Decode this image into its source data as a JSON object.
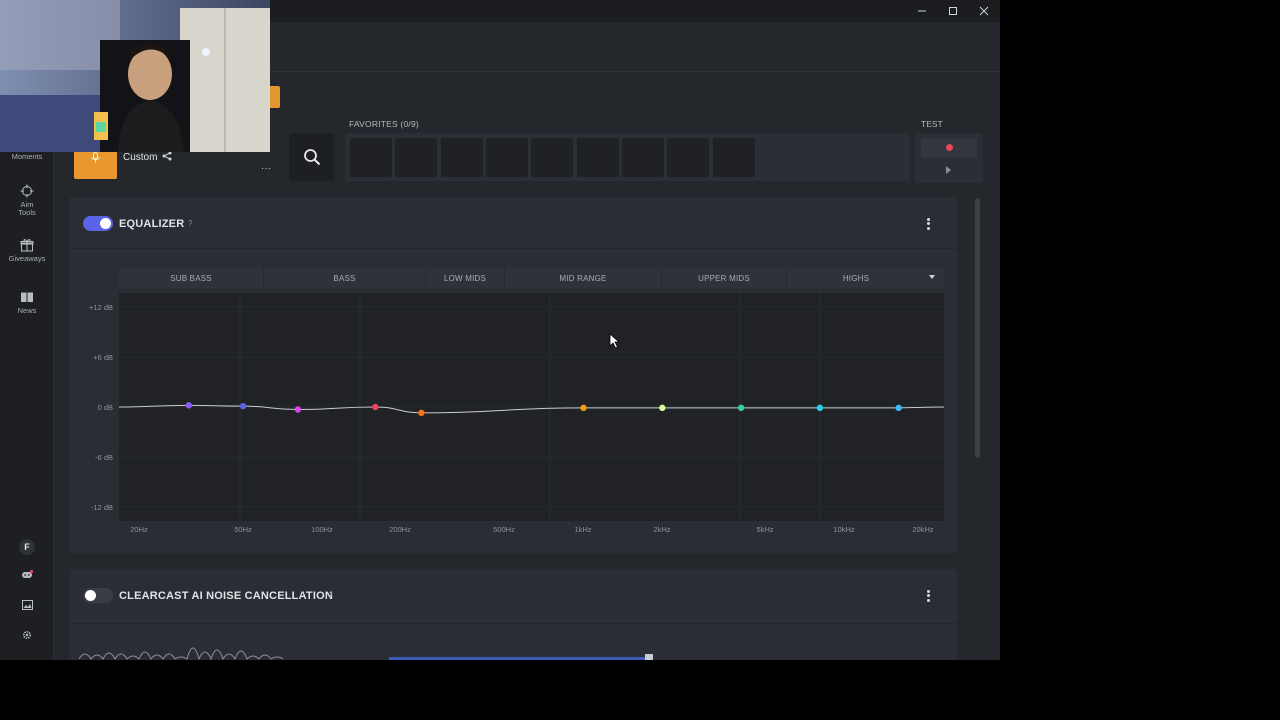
{
  "window": {
    "minimize_icon": "minimize-icon",
    "maximize_icon": "maximize-icon",
    "close_icon": "close-icon"
  },
  "sidebar": {
    "items": [
      {
        "label": "Moments",
        "icon": "moments-icon"
      },
      {
        "label": "Aim\nTools",
        "icon": "crosshair-icon"
      },
      {
        "label": "Giveaways",
        "icon": "gift-icon"
      },
      {
        "label": "News",
        "icon": "newspaper-icon"
      }
    ],
    "profile_initial": "F",
    "bottom_icons": [
      "discord-icon",
      "image-icon",
      "settings-icon"
    ]
  },
  "preset": {
    "name": "Custom",
    "share_icon": "share-icon",
    "more_label": "···"
  },
  "favorites": {
    "label": "FAVORITES (0/9)",
    "slots": 9
  },
  "test": {
    "label": "TEST",
    "record_color": "#e8455b"
  },
  "equalizer": {
    "title": "EQUALIZER",
    "help": "?",
    "enabled": true,
    "toggle_color": "#5b63e8",
    "bands": [
      "SUB BASS",
      "BASS",
      "LOW MIDS",
      "MID RANGE",
      "UPPER MIDS",
      "HIGHS"
    ],
    "db_labels": [
      "+12 dB",
      "+6 dB",
      "0 dB",
      "-6 dB",
      "-12 dB"
    ],
    "hz_labels": [
      "20Hz",
      "50Hz",
      "100Hz",
      "200Hz",
      "500Hz",
      "1kHz",
      "2kHz",
      "5kHz",
      "10kHz",
      "20kHz"
    ]
  },
  "chart_data": {
    "type": "line",
    "x_scale": "log",
    "xlim": [
      20,
      20000
    ],
    "ylim": [
      -12,
      12
    ],
    "x_ticks": [
      "20Hz",
      "50Hz",
      "100Hz",
      "200Hz",
      "500Hz",
      "1kHz",
      "2kHz",
      "5kHz",
      "10kHz",
      "20kHz"
    ],
    "y_ticks": [
      "+12 dB",
      "+6 dB",
      "0 dB",
      "-6 dB",
      "-12 dB"
    ],
    "points": [
      {
        "x": 31,
        "y": 0.2,
        "color": "#8b5cf6"
      },
      {
        "x": 50,
        "y": 0.1,
        "color": "#5b63e8"
      },
      {
        "x": 81,
        "y": -0.3,
        "color": "#d946ef"
      },
      {
        "x": 160,
        "y": 0.0,
        "color": "#f43f5e"
      },
      {
        "x": 240,
        "y": -0.7,
        "color": "#f97316"
      },
      {
        "x": 1000,
        "y": -0.1,
        "color": "#f59e0b"
      },
      {
        "x": 2000,
        "y": -0.1,
        "color": "#d9f99d"
      },
      {
        "x": 4000,
        "y": -0.1,
        "color": "#34d399"
      },
      {
        "x": 8000,
        "y": -0.1,
        "color": "#22d3ee"
      },
      {
        "x": 16000,
        "y": -0.1,
        "color": "#38bdf8"
      }
    ]
  },
  "noise_cancellation": {
    "title": "CLEARCAST AI NOISE CANCELLATION",
    "help": "?",
    "enabled": false
  }
}
